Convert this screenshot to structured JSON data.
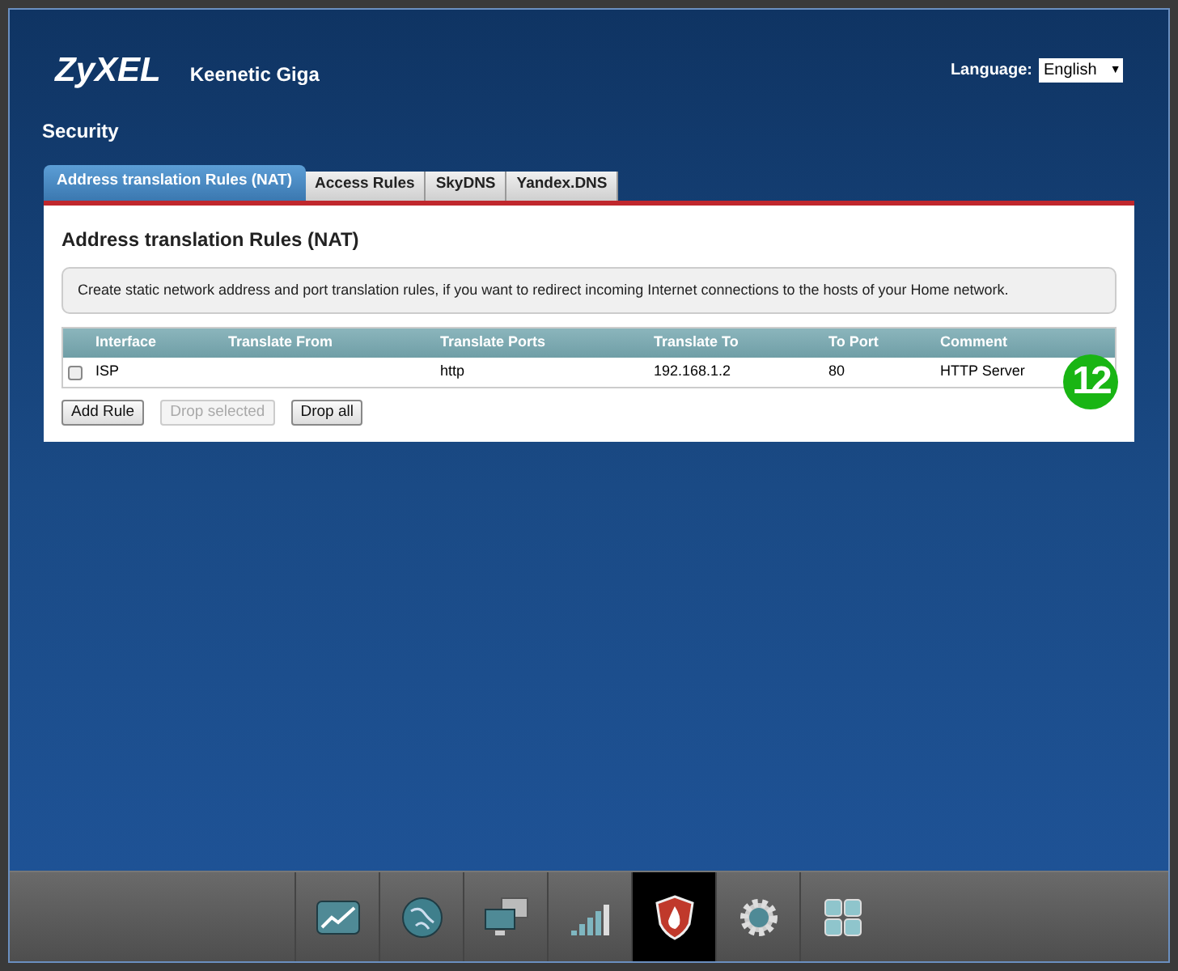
{
  "header": {
    "brand": "ZyXEL",
    "model": "Keenetic Giga",
    "language_label": "Language:",
    "language": "English",
    "caret": "▼"
  },
  "page_title": "Security",
  "tabs": [
    {
      "label": "Address translation Rules (NAT)",
      "selected": true
    },
    {
      "label": "Access Rules",
      "selected": false
    },
    {
      "label": "SkyDNS",
      "selected": false
    },
    {
      "label": "Yandex.DNS",
      "selected": false
    }
  ],
  "panel": {
    "title": "Address translation Rules (NAT)",
    "info": "Create static network address and port translation rules, if you want to redirect incoming Internet connections to the hosts of your Home network.",
    "table": {
      "columns": [
        "Interface",
        "Translate From",
        "Translate Ports",
        "Translate To",
        "To Port",
        "Comment"
      ],
      "rows": [
        {
          "checked": false,
          "cells": [
            "ISP",
            "",
            "http",
            "192.168.1.2",
            "80",
            "HTTP Server"
          ]
        }
      ]
    },
    "buttons": [
      {
        "label": "Add Rule",
        "disabled": false
      },
      {
        "label": "Drop selected",
        "disabled": true
      },
      {
        "label": "Drop all",
        "disabled": false
      }
    ],
    "step_badge": "12"
  },
  "dock": [
    {
      "kind": "chart",
      "selected": false
    },
    {
      "kind": "globe",
      "selected": false
    },
    {
      "kind": "computers",
      "selected": false
    },
    {
      "kind": "signal",
      "selected": false
    },
    {
      "kind": "shield",
      "selected": true
    },
    {
      "kind": "gear",
      "selected": false
    },
    {
      "kind": "grid",
      "selected": false
    }
  ]
}
